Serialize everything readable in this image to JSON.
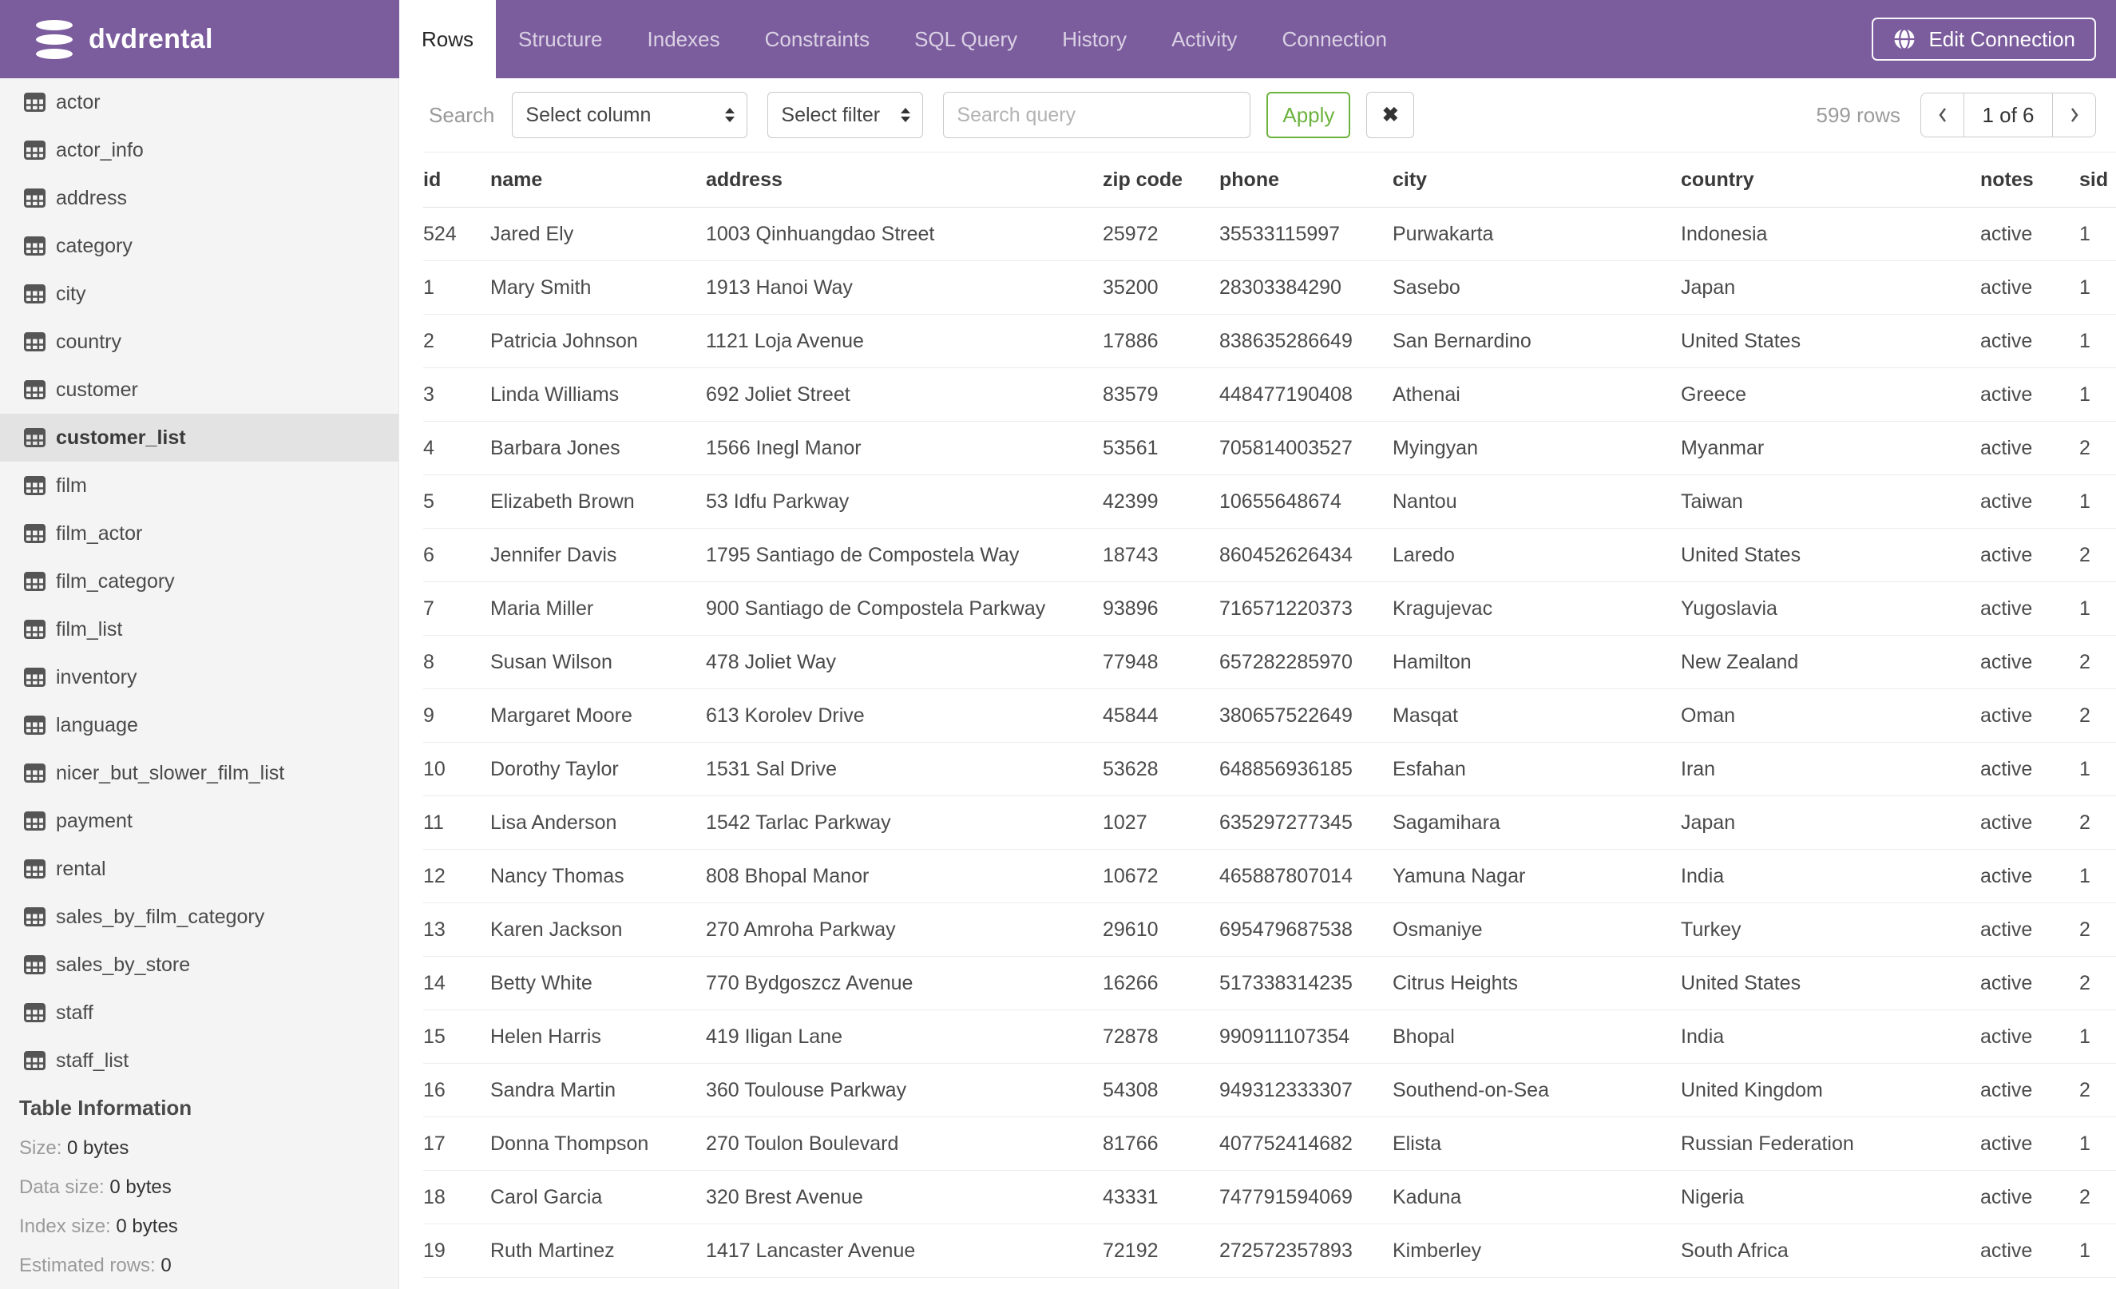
{
  "colors": {
    "accent": "#7B5C9D",
    "green": "#6CB33E",
    "sidebar_bg": "#f4f4f4",
    "selected_item_bg": "#e3e3e3"
  },
  "header": {
    "database": "dvdrental",
    "tabs": [
      {
        "label": "Rows",
        "active": true
      },
      {
        "label": "Structure"
      },
      {
        "label": "Indexes"
      },
      {
        "label": "Constraints"
      },
      {
        "label": "SQL Query"
      },
      {
        "label": "History"
      },
      {
        "label": "Activity"
      },
      {
        "label": "Connection"
      }
    ],
    "edit_connection_label": "Edit Connection"
  },
  "sidebar": {
    "tables": [
      {
        "label": "actor"
      },
      {
        "label": "actor_info"
      },
      {
        "label": "address"
      },
      {
        "label": "category"
      },
      {
        "label": "city"
      },
      {
        "label": "country"
      },
      {
        "label": "customer"
      },
      {
        "label": "customer_list",
        "selected": true
      },
      {
        "label": "film"
      },
      {
        "label": "film_actor"
      },
      {
        "label": "film_category"
      },
      {
        "label": "film_list"
      },
      {
        "label": "inventory"
      },
      {
        "label": "language"
      },
      {
        "label": "nicer_but_slower_film_list"
      },
      {
        "label": "payment"
      },
      {
        "label": "rental"
      },
      {
        "label": "sales_by_film_category"
      },
      {
        "label": "sales_by_store"
      },
      {
        "label": "staff"
      },
      {
        "label": "staff_list"
      }
    ],
    "table_information": {
      "title": "Table Information",
      "fields": [
        {
          "label": "Size:",
          "value": "0 bytes"
        },
        {
          "label": "Data size:",
          "value": "0 bytes"
        },
        {
          "label": "Index size:",
          "value": "0 bytes"
        },
        {
          "label": "Estimated rows:",
          "value": "0"
        }
      ]
    }
  },
  "toolbar": {
    "search_label": "Search",
    "column_select_value": "Select column",
    "filter_select_value": "Select filter",
    "query_placeholder": "Search query",
    "apply_label": "Apply",
    "clear_label": "✖",
    "rows_count": "599 rows",
    "page_indicator": "1 of 6"
  },
  "table": {
    "columns": [
      "id",
      "name",
      "address",
      "zip code",
      "phone",
      "city",
      "country",
      "notes",
      "sid"
    ],
    "rows": [
      [
        "524",
        "Jared Ely",
        "1003 Qinhuangdao Street",
        "25972",
        "35533115997",
        "Purwakarta",
        "Indonesia",
        "active",
        "1"
      ],
      [
        "1",
        "Mary Smith",
        "1913 Hanoi Way",
        "35200",
        "28303384290",
        "Sasebo",
        "Japan",
        "active",
        "1"
      ],
      [
        "2",
        "Patricia Johnson",
        "1121 Loja Avenue",
        "17886",
        "838635286649",
        "San Bernardino",
        "United States",
        "active",
        "1"
      ],
      [
        "3",
        "Linda Williams",
        "692 Joliet Street",
        "83579",
        "448477190408",
        "Athenai",
        "Greece",
        "active",
        "1"
      ],
      [
        "4",
        "Barbara Jones",
        "1566 Inegl Manor",
        "53561",
        "705814003527",
        "Myingyan",
        "Myanmar",
        "active",
        "2"
      ],
      [
        "5",
        "Elizabeth Brown",
        "53 Idfu Parkway",
        "42399",
        "10655648674",
        "Nantou",
        "Taiwan",
        "active",
        "1"
      ],
      [
        "6",
        "Jennifer Davis",
        "1795 Santiago de Compostela Way",
        "18743",
        "860452626434",
        "Laredo",
        "United States",
        "active",
        "2"
      ],
      [
        "7",
        "Maria Miller",
        "900 Santiago de Compostela Parkway",
        "93896",
        "716571220373",
        "Kragujevac",
        "Yugoslavia",
        "active",
        "1"
      ],
      [
        "8",
        "Susan Wilson",
        "478 Joliet Way",
        "77948",
        "657282285970",
        "Hamilton",
        "New Zealand",
        "active",
        "2"
      ],
      [
        "9",
        "Margaret Moore",
        "613 Korolev Drive",
        "45844",
        "380657522649",
        "Masqat",
        "Oman",
        "active",
        "2"
      ],
      [
        "10",
        "Dorothy Taylor",
        "1531 Sal Drive",
        "53628",
        "648856936185",
        "Esfahan",
        "Iran",
        "active",
        "1"
      ],
      [
        "11",
        "Lisa Anderson",
        "1542 Tarlac Parkway",
        "1027",
        "635297277345",
        "Sagamihara",
        "Japan",
        "active",
        "2"
      ],
      [
        "12",
        "Nancy Thomas",
        "808 Bhopal Manor",
        "10672",
        "465887807014",
        "Yamuna Nagar",
        "India",
        "active",
        "1"
      ],
      [
        "13",
        "Karen Jackson",
        "270 Amroha Parkway",
        "29610",
        "695479687538",
        "Osmaniye",
        "Turkey",
        "active",
        "2"
      ],
      [
        "14",
        "Betty White",
        "770 Bydgoszcz Avenue",
        "16266",
        "517338314235",
        "Citrus Heights",
        "United States",
        "active",
        "2"
      ],
      [
        "15",
        "Helen Harris",
        "419 Iligan Lane",
        "72878",
        "990911107354",
        "Bhopal",
        "India",
        "active",
        "1"
      ],
      [
        "16",
        "Sandra Martin",
        "360 Toulouse Parkway",
        "54308",
        "949312333307",
        "Southend-on-Sea",
        "United Kingdom",
        "active",
        "2"
      ],
      [
        "17",
        "Donna Thompson",
        "270 Toulon Boulevard",
        "81766",
        "407752414682",
        "Elista",
        "Russian Federation",
        "active",
        "1"
      ],
      [
        "18",
        "Carol Garcia",
        "320 Brest Avenue",
        "43331",
        "747791594069",
        "Kaduna",
        "Nigeria",
        "active",
        "2"
      ],
      [
        "19",
        "Ruth Martinez",
        "1417 Lancaster Avenue",
        "72192",
        "272572357893",
        "Kimberley",
        "South Africa",
        "active",
        "1"
      ]
    ]
  }
}
